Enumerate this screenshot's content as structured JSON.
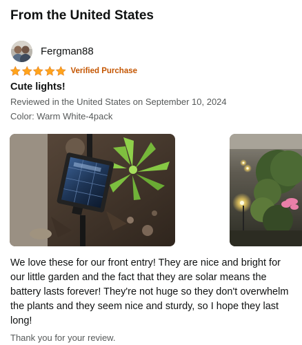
{
  "section": {
    "title": "From the United States"
  },
  "reviewer": {
    "name": "Fergman88"
  },
  "rating": {
    "stars": 5,
    "max": 5,
    "verified_label": "Verified Purchase"
  },
  "review": {
    "title": "Cute lights!",
    "date_line": "Reviewed in the United States on September 10, 2024",
    "variant": "Color: Warm White-4pack",
    "body": "We love these for our front entry! They are nice and bright for our little garden and the fact that they are solar means the battery lasts forever! They're not huge so they don't overwhelm the plants and they seem nice and sturdy, so I hope they last long!",
    "thanks": "Thank you for your review."
  },
  "colors": {
    "star": "#ffa41c",
    "verified": "#c45500",
    "secondary_text": "#565959",
    "primary_text": "#0f1111"
  },
  "icons": {
    "star": "star-icon"
  }
}
